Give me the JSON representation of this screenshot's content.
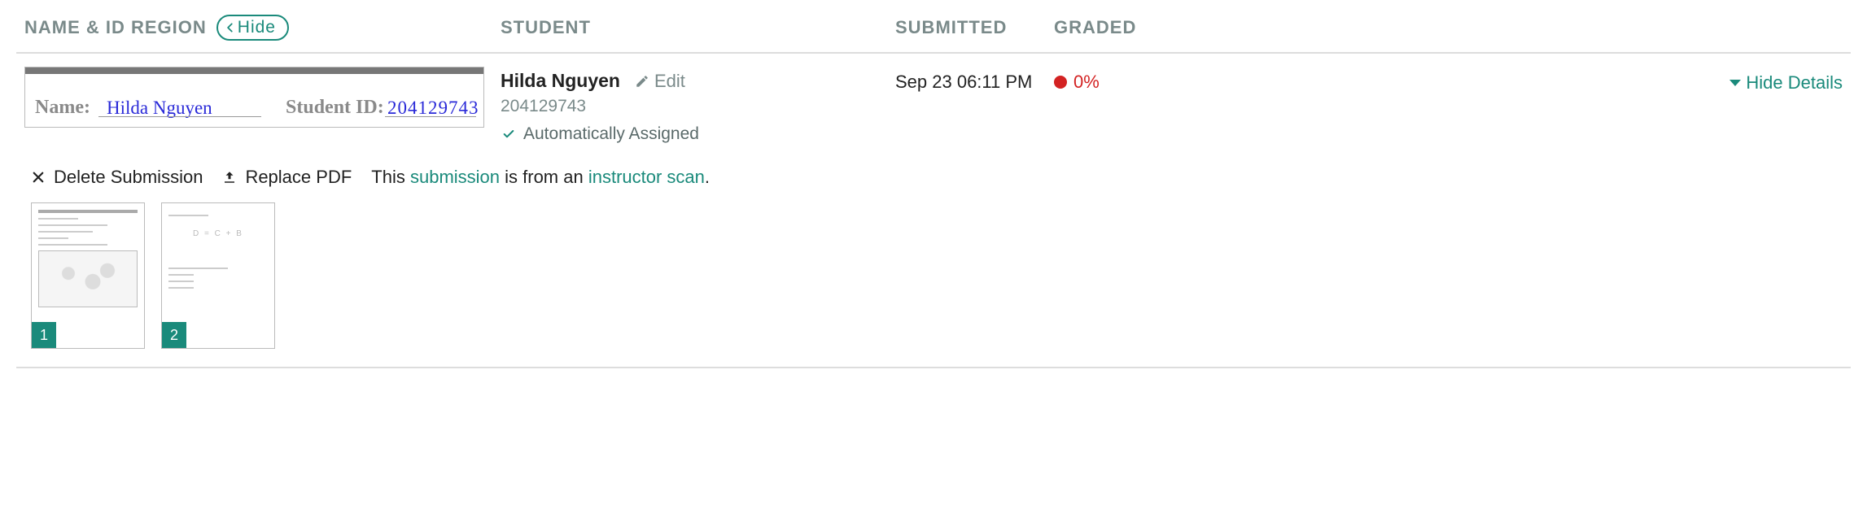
{
  "headers": {
    "name_id": "NAME & ID REGION",
    "student": "STUDENT",
    "submitted": "SUBMITTED",
    "graded": "GRADED",
    "hide_button": "Hide"
  },
  "scan_region": {
    "name_label": "Name:",
    "id_label": "Student ID:",
    "handwritten_name": "Hilda Nguyen",
    "handwritten_id": "204129743"
  },
  "student": {
    "name": "Hilda Nguyen",
    "edit_label": "Edit",
    "id": "204129743",
    "auto_assigned": "Automatically Assigned"
  },
  "submitted": "Sep 23 06:11 PM",
  "graded": {
    "percent": "0%"
  },
  "toggle": {
    "hide_details": "Hide Details"
  },
  "actions": {
    "delete": "Delete Submission",
    "replace": "Replace PDF",
    "scan_prefix": "This ",
    "submission_link": "submission",
    "scan_mid": " is from an ",
    "instructor_link": "instructor scan",
    "scan_suffix": "."
  },
  "pages": [
    {
      "num": "1"
    },
    {
      "num": "2"
    }
  ]
}
